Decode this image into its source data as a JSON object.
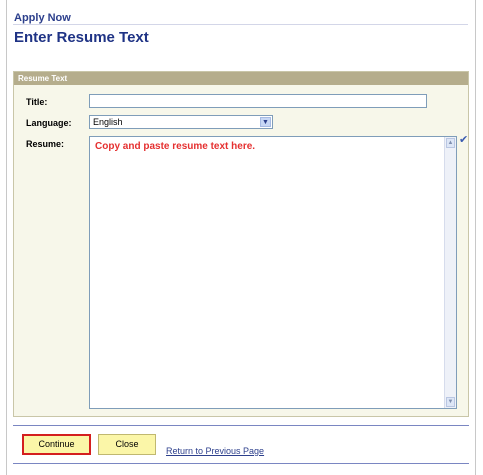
{
  "breadcrumb": "Apply Now",
  "page_title": "Enter Resume Text",
  "section": {
    "header": "Resume Text",
    "fields": {
      "title_label": "Title:",
      "title_value": "",
      "language_label": "Language:",
      "language_value": "English",
      "resume_label": "Resume:",
      "resume_placeholder": "Copy and paste resume text here."
    }
  },
  "icons": {
    "spell_check": "spell-check-icon",
    "select_arrow": "chevron-down-icon"
  },
  "footer": {
    "continue_label": "Continue",
    "close_label": "Close",
    "return_link": "Return to Previous Page"
  },
  "colors": {
    "title_blue": "#1f3385",
    "section_header_bg": "#b5ad8c",
    "section_bg": "#f7f7ea",
    "button_bg": "#fbf6a8",
    "continue_border": "#d41f1f",
    "placeholder_red": "#e53030"
  }
}
